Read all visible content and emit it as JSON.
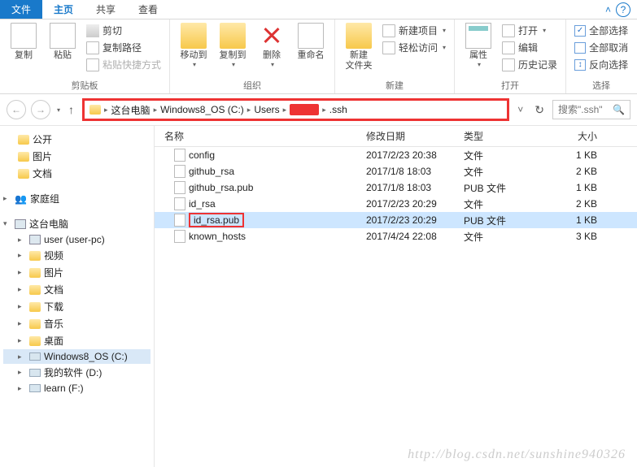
{
  "tabs": {
    "file": "文件",
    "home": "主页",
    "share": "共享",
    "view": "查看"
  },
  "ribbon": {
    "clipboard": {
      "label": "剪贴板",
      "copy": "复制",
      "paste": "粘贴",
      "cut": "剪切",
      "copy_path": "复制路径",
      "paste_shortcut": "粘贴快捷方式"
    },
    "organize": {
      "label": "组织",
      "move_to": "移动到",
      "copy_to": "复制到",
      "delete": "删除",
      "rename": "重命名"
    },
    "new": {
      "label": "新建",
      "new_folder": "新建\n文件夹",
      "new_item": "新建项目",
      "easy_access": "轻松访问"
    },
    "open": {
      "label": "打开",
      "properties": "属性",
      "open": "打开",
      "edit": "编辑",
      "history": "历史记录"
    },
    "select": {
      "label": "选择",
      "select_all": "全部选择",
      "select_none": "全部取消",
      "invert": "反向选择"
    }
  },
  "breadcrumb": {
    "seg1": "这台电脑",
    "seg2": "Windows8_OS (C:)",
    "seg3": "Users",
    "seg5": ".ssh"
  },
  "search": {
    "placeholder": "搜索\".ssh\""
  },
  "tree": {
    "public": "公开",
    "pictures": "图片",
    "documents": "文档",
    "homegroup": "家庭组",
    "thispc": "这台电脑",
    "user": "user (user-pc)",
    "videos": "视频",
    "pictures2": "图片",
    "documents2": "文档",
    "downloads": "下载",
    "music": "音乐",
    "desktop": "桌面",
    "drive_c": "Windows8_OS (C:)",
    "drive_d": "我的软件 (D:)",
    "drive_f": "learn (F:)"
  },
  "columns": {
    "name": "名称",
    "date": "修改日期",
    "type": "类型",
    "size": "大小"
  },
  "files": [
    {
      "name": "config",
      "date": "2017/2/23 20:38",
      "type": "文件",
      "size": "1 KB",
      "selected": false,
      "boxed": false
    },
    {
      "name": "github_rsa",
      "date": "2017/1/8 18:03",
      "type": "文件",
      "size": "2 KB",
      "selected": false,
      "boxed": false
    },
    {
      "name": "github_rsa.pub",
      "date": "2017/1/8 18:03",
      "type": "PUB 文件",
      "size": "1 KB",
      "selected": false,
      "boxed": false
    },
    {
      "name": "id_rsa",
      "date": "2017/2/23 20:29",
      "type": "文件",
      "size": "2 KB",
      "selected": false,
      "boxed": false
    },
    {
      "name": "id_rsa.pub",
      "date": "2017/2/23 20:29",
      "type": "PUB 文件",
      "size": "1 KB",
      "selected": true,
      "boxed": true
    },
    {
      "name": "known_hosts",
      "date": "2017/4/24 22:08",
      "type": "文件",
      "size": "3 KB",
      "selected": false,
      "boxed": false
    }
  ],
  "watermark": "http://blog.csdn.net/sunshine940326"
}
